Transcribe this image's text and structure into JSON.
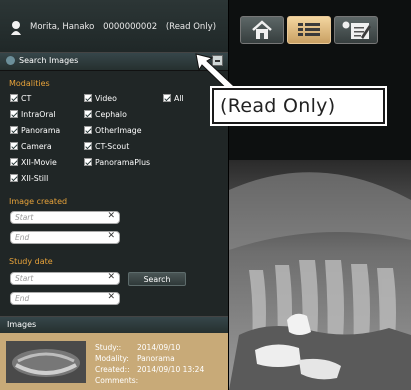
{
  "patient": {
    "name": "Morita, Hanako",
    "id": "0000000002",
    "mode": "(Read Only)"
  },
  "search_panel": {
    "title": "Search Images",
    "modalities_label": "Modalities",
    "modalities": [
      {
        "label": "CT",
        "checked": true
      },
      {
        "label": "Video",
        "checked": true
      },
      {
        "label": "All",
        "checked": true
      },
      {
        "label": "IntraOral",
        "checked": true
      },
      {
        "label": "Cephalo",
        "checked": true
      },
      {
        "label": "Panorama",
        "checked": true
      },
      {
        "label": "OtherImage",
        "checked": true
      },
      {
        "label": "Camera",
        "checked": true
      },
      {
        "label": "CT-Scout",
        "checked": true
      },
      {
        "label": "XII-Movie",
        "checked": true
      },
      {
        "label": "PanoramaPlus",
        "checked": true
      },
      {
        "label": "XII-Still",
        "checked": true
      }
    ],
    "image_created_label": "Image created",
    "study_date_label": "Study date",
    "start_placeholder": "Start",
    "end_placeholder": "End",
    "clear_glyph": "✕",
    "search_button": "Search"
  },
  "images_panel": {
    "title": "Images",
    "item": {
      "study_key": "Study::",
      "study_value": "2014/09/10",
      "modality_key": "Modality:",
      "modality_value": "Panorama",
      "created_key": "Created::",
      "created_value": "2014/09/10 13:24",
      "comments_key": "Comments:",
      "comments_value": ""
    }
  },
  "toolbar": {
    "icons": [
      "home-icon",
      "list-icon",
      "edit-icon"
    ],
    "active": "list-icon"
  },
  "callout": {
    "text": "(Read Only)"
  },
  "colors": {
    "section_label": "#e8a33a",
    "panel_bg": "#202626",
    "thumb_card": "#c8aa78",
    "active_tool": "#e0b878"
  }
}
